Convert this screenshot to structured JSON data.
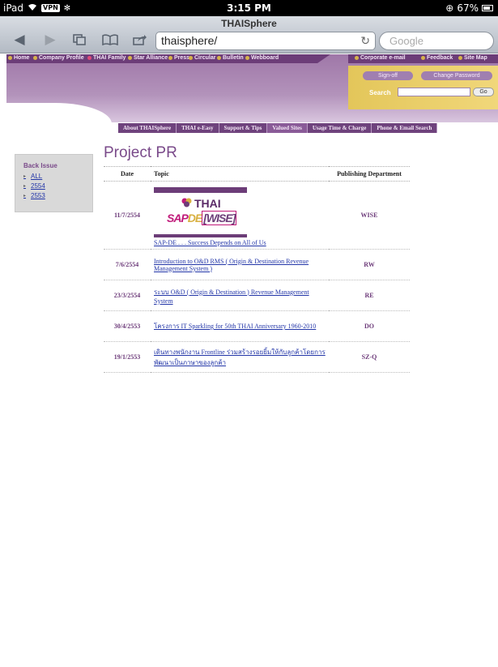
{
  "status_bar": {
    "device": "iPad",
    "vpn": "VPN",
    "time": "3:15 PM",
    "battery": "67%"
  },
  "browser": {
    "title": "THAISphere",
    "url": "thaisphere/",
    "search_placeholder": "Google"
  },
  "site": {
    "top_nav": [
      "Home",
      "Company Profile",
      "THAI Family",
      "Star Alliance",
      "Press",
      "Circular",
      "Bulletin",
      "Webboard"
    ],
    "right_nav": [
      "Corporate e-mail",
      "Feedback",
      "Site Map"
    ],
    "sign_off": "Sign-off",
    "change_password": "Change Password",
    "search_label": "Search",
    "go_label": "Go",
    "main_nav": [
      "About THAISphere",
      "THAI e-Easy",
      "Support & Tips",
      "Valued Sites",
      "Usage Time & Charge",
      "Phone & Email Search"
    ]
  },
  "sidebar": {
    "title": "Back Issue",
    "items": [
      "ALL",
      "2554",
      "2553"
    ]
  },
  "page": {
    "title": "Project PR"
  },
  "table": {
    "headers": [
      "Date",
      "Topic",
      "Publishing Department"
    ],
    "banner": {
      "brand": "THAI",
      "sap": "SAP",
      "de": "DE",
      "wise": "[WISE]"
    },
    "rows": [
      {
        "date": "11/7/2554",
        "topic": "SAP-DE . . . Success Depends on All of Us",
        "dept": "WISE"
      },
      {
        "date": "7/6/2554",
        "topic": "Introduction to O&D RMS ( Origin & Destination Revenue Management System )",
        "dept": "RW"
      },
      {
        "date": "23/3/2554",
        "topic": "ระบบ O&D ( Origin & Destination ) Revenue Management System",
        "dept": "RE"
      },
      {
        "date": "30/4/2553",
        "topic": "โครงการ IT Sparkling for 50th THAI Anniversary 1960-2010",
        "dept": "DO"
      },
      {
        "date": "19/1/2553",
        "topic": "เดินทางพนักงาน Frontline ร่วมสร้างรอยยิ้มให้กับลูกค้าโดยการพัฒนาเป็นภาษาของลูกค้า",
        "dept": "SZ-Q"
      }
    ]
  }
}
